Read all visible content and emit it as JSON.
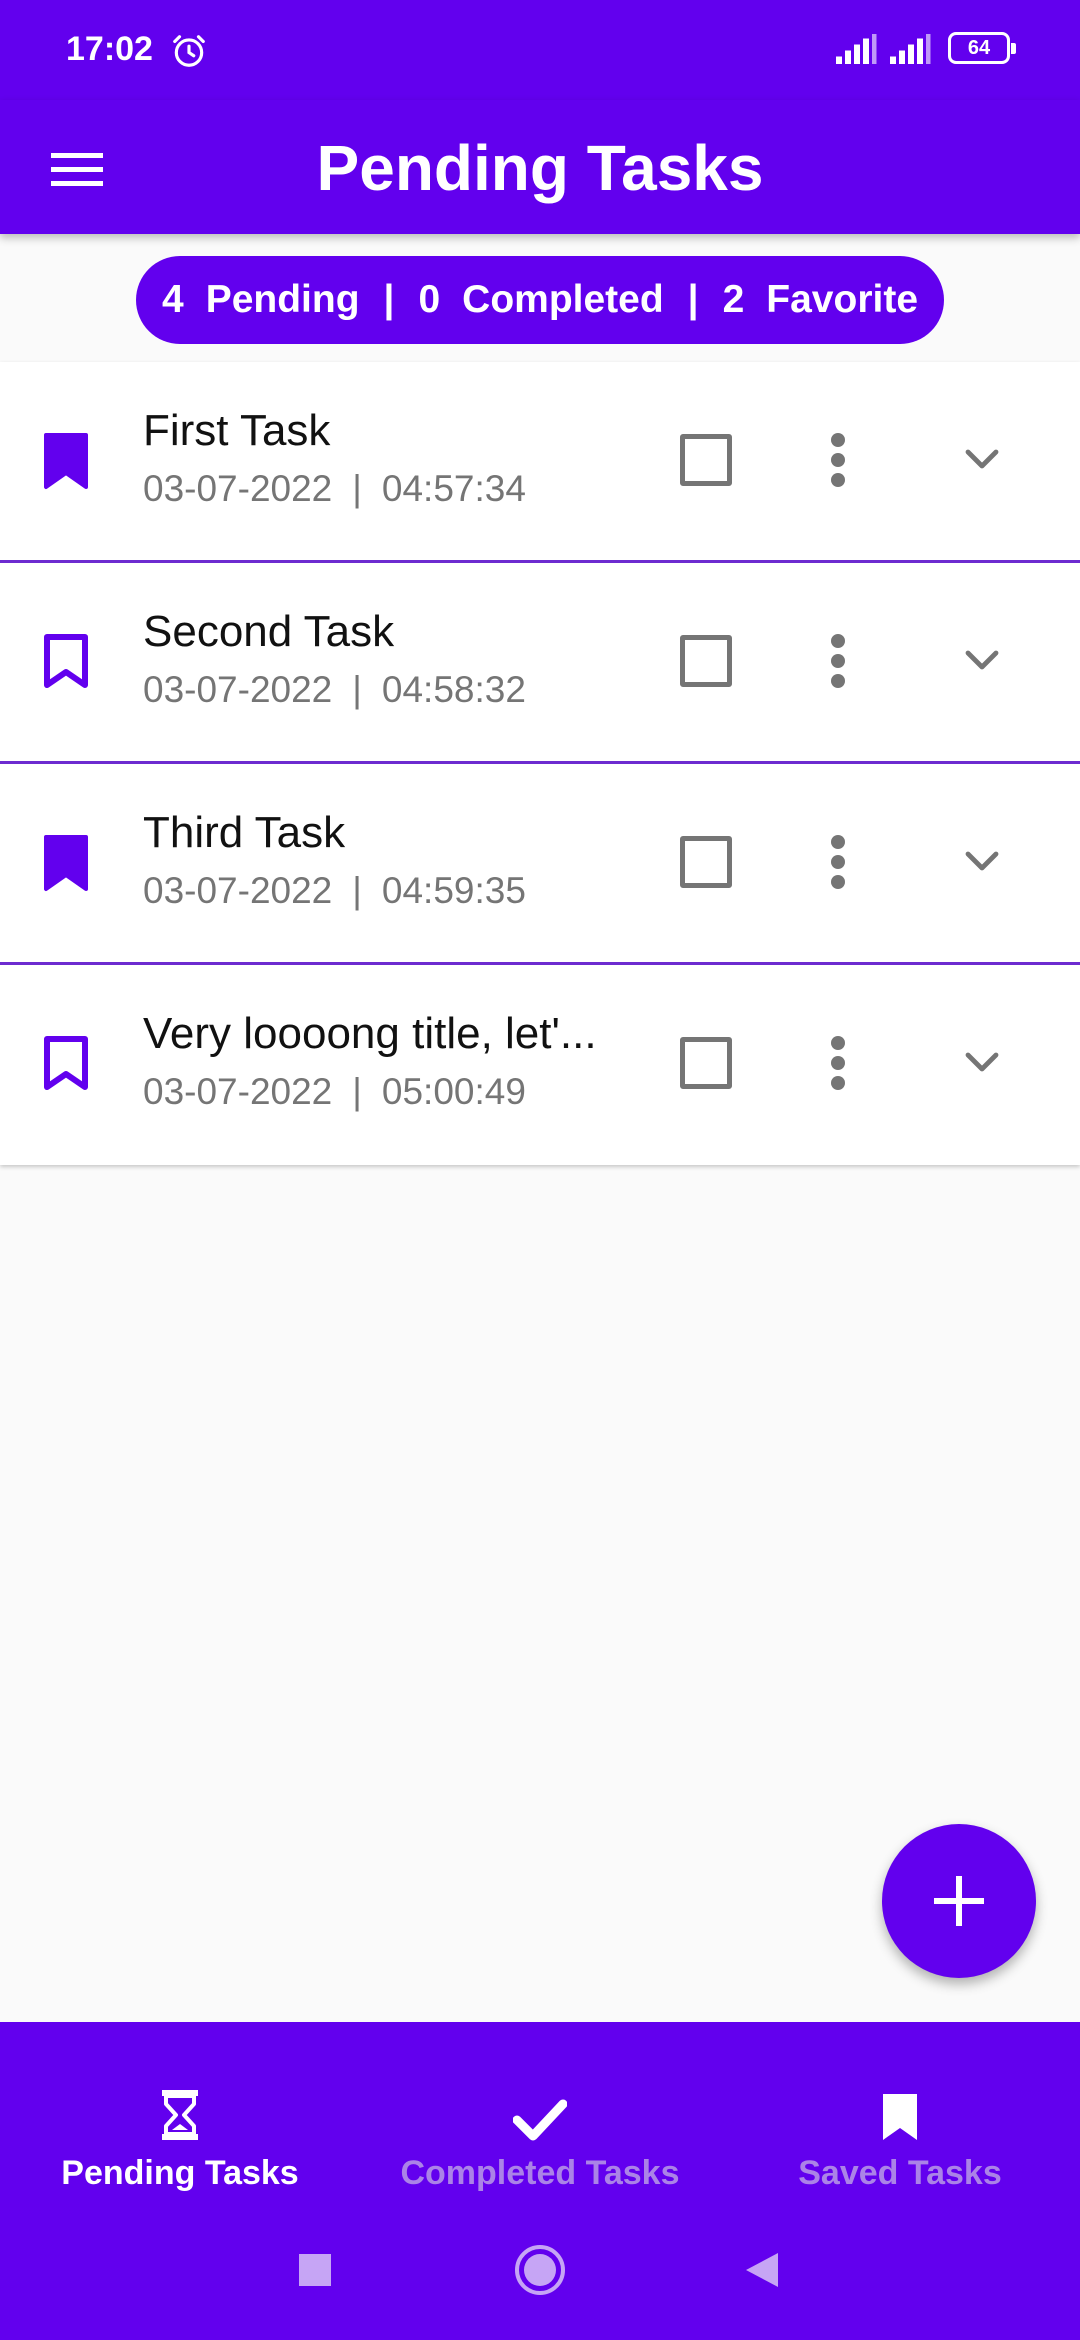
{
  "status_bar": {
    "time": "17:02",
    "battery": "64",
    "icons": [
      "alarm-icon",
      "signal-icon",
      "signal-icon",
      "battery-icon"
    ]
  },
  "app_bar": {
    "title": "Pending Tasks",
    "menu_icon": "hamburger-menu-icon"
  },
  "summary": {
    "pending_count": "4",
    "pending_label": "Pending",
    "completed_count": "0",
    "completed_label": "Completed",
    "favorite_count": "2",
    "favorite_label": "Favorite",
    "separator": "|"
  },
  "tasks": [
    {
      "title": "First Task",
      "date": "03-07-2022",
      "time": "04:57:34",
      "favorite": true,
      "checked": false
    },
    {
      "title": "Second Task",
      "date": "03-07-2022",
      "time": "04:58:32",
      "favorite": false,
      "checked": false
    },
    {
      "title": "Third Task",
      "date": "03-07-2022",
      "time": "04:59:35",
      "favorite": true,
      "checked": false
    },
    {
      "title": "Very loooong title, let'...",
      "date": "03-07-2022",
      "time": "05:00:49",
      "favorite": false,
      "checked": false
    }
  ],
  "meta_separator": "|",
  "fab": {
    "icon": "plus-icon"
  },
  "bottom_nav": {
    "items": [
      {
        "label": "Pending Tasks",
        "icon": "hourglass-icon",
        "active": true
      },
      {
        "label": "Completed Tasks",
        "icon": "check-icon",
        "active": false
      },
      {
        "label": "Saved Tasks",
        "icon": "bookmark-icon",
        "active": false
      }
    ]
  },
  "colors": {
    "primary": "#6200ee",
    "divider": "#6d2bd0",
    "secondary_text": "#757575",
    "inactive_nav": "#b89be6",
    "background": "#fafafa"
  }
}
